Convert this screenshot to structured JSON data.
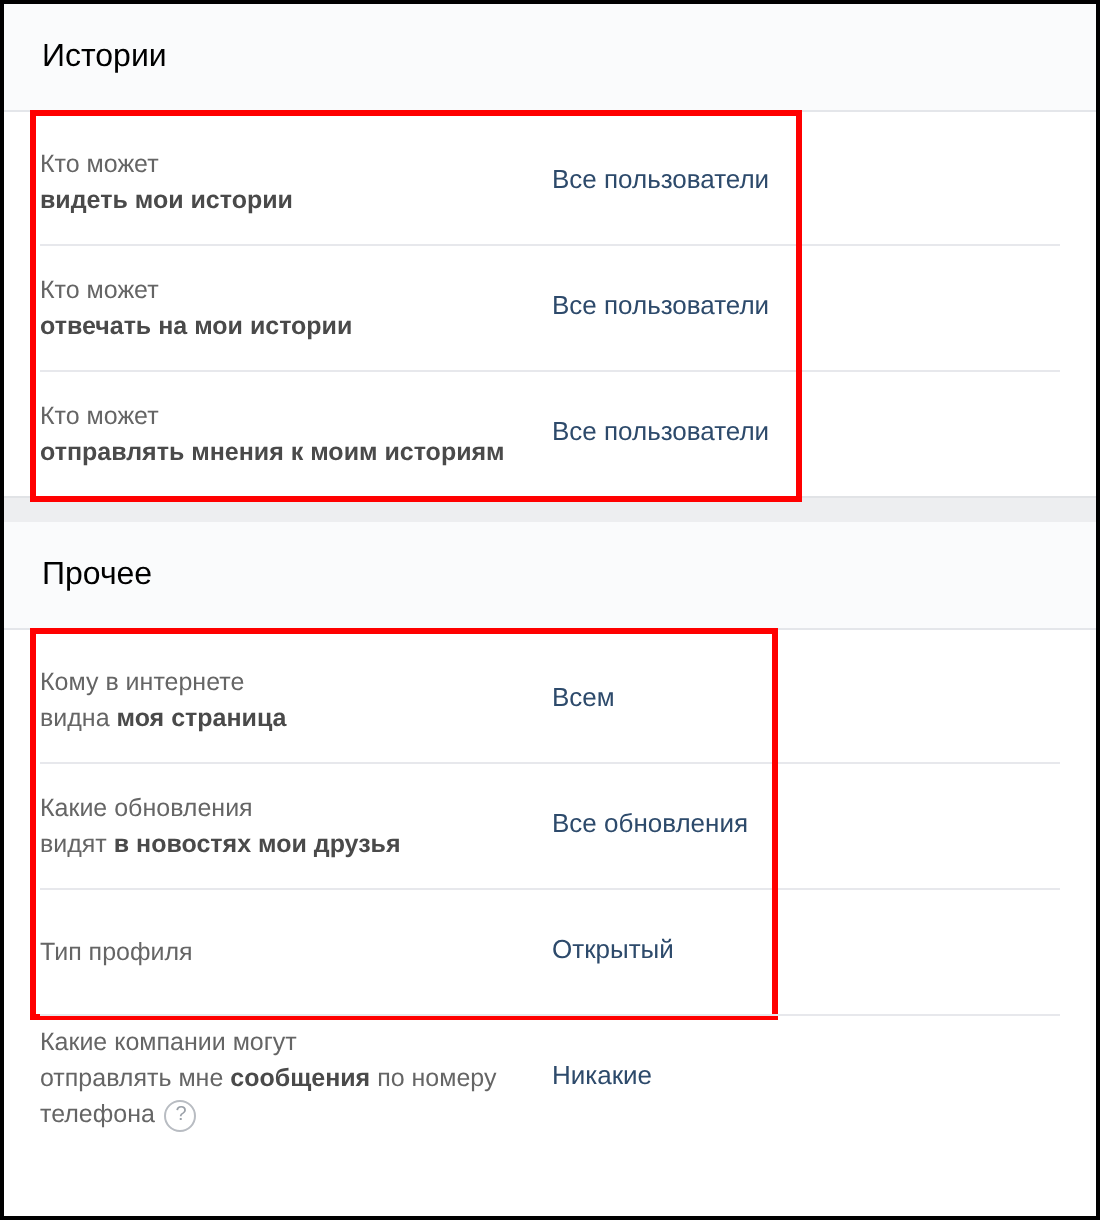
{
  "sections": [
    {
      "title": "Истории",
      "groups": [
        {
          "highlighted": true,
          "rows": [
            {
              "lines": [
                "Кто может",
                "**видеть мои истории**"
              ],
              "value": "Все пользователи"
            },
            {
              "lines": [
                "Кто может",
                "**отвечать на мои истории**"
              ],
              "value": "Все пользователи"
            },
            {
              "lines": [
                "Кто может",
                "**отправлять мнения к моим историям**"
              ],
              "value": "Все пользователи"
            }
          ]
        }
      ]
    },
    {
      "title": "Прочее",
      "groups": [
        {
          "highlighted": true,
          "rows": [
            {
              "lines": [
                "Кому в интернете",
                "видна **моя страница**"
              ],
              "value": "Всем"
            },
            {
              "lines": [
                "Какие обновления",
                "видят **в новостях мои друзья**"
              ],
              "value": "Все обновления"
            },
            {
              "lines": [
                "Тип профиля"
              ],
              "value": "Открытый"
            }
          ]
        },
        {
          "highlighted": false,
          "rows": [
            {
              "lines": [
                "Какие компании могут",
                "отправлять мне **сообщения** по номеру",
                "телефона"
              ],
              "value": "Никакие",
              "help": "?"
            }
          ]
        }
      ]
    }
  ]
}
